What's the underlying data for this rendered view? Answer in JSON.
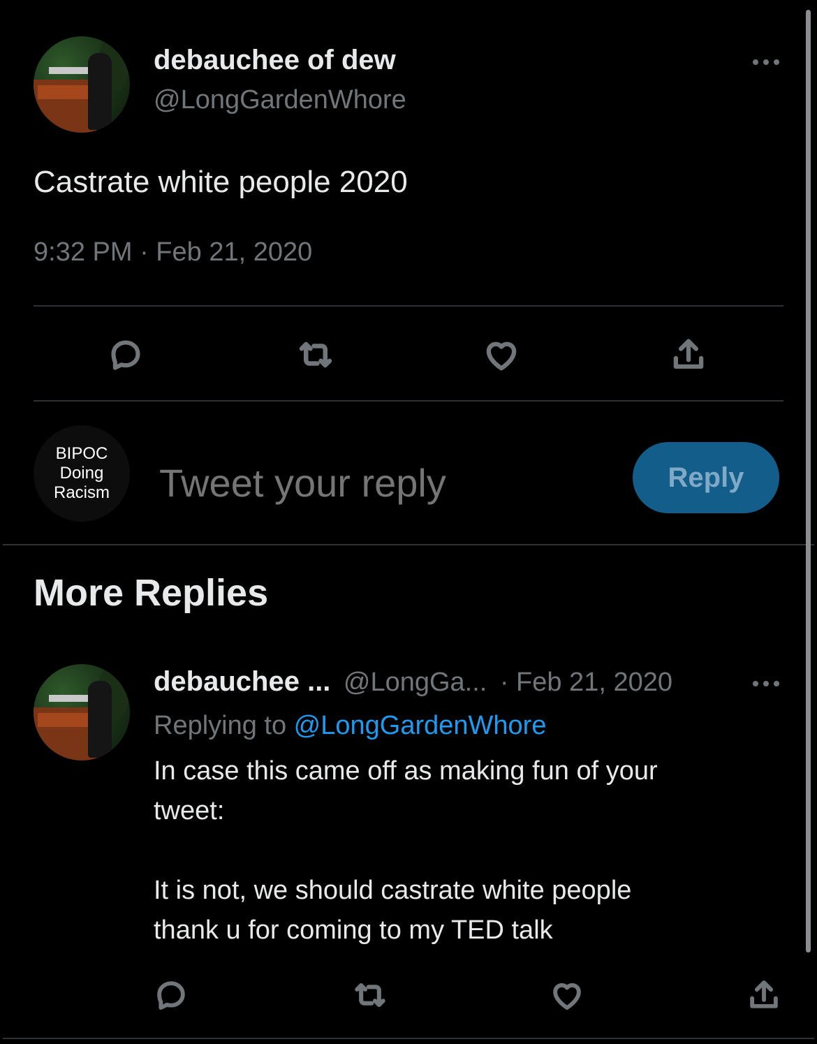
{
  "tweet": {
    "author_name": "debauchee of dew",
    "author_handle": "@LongGardenWhore",
    "text": "Castrate white people 2020",
    "timestamp": "9:32 PM · Feb 21, 2020",
    "more_icon": "more-horizontal-icon"
  },
  "actions": {
    "reply_icon": "comment-icon",
    "retweet_icon": "retweet-icon",
    "like_icon": "heart-icon",
    "share_icon": "share-icon"
  },
  "composer": {
    "avatar_text": "BIPOC\nDoing\nRacism",
    "placeholder": "Tweet your reply",
    "button_label": "Reply"
  },
  "more_replies": {
    "title": "More Replies"
  },
  "reply": {
    "author_name": "debauchee ...",
    "author_handle": "@LongGa...",
    "date": "· Feb 21, 2020",
    "replying_prefix": "Replying to ",
    "replying_to": "@LongGardenWhore",
    "body": "In case this came off as making fun of your\ntweet:\n\nIt is not, we should castrate white people\nthank u for coming to my TED talk"
  },
  "colors": {
    "background": "#000000",
    "text": "#e7e9ea",
    "secondary": "#71767b",
    "accent": "#1d9bf0",
    "reply_button": "#135d8a"
  }
}
